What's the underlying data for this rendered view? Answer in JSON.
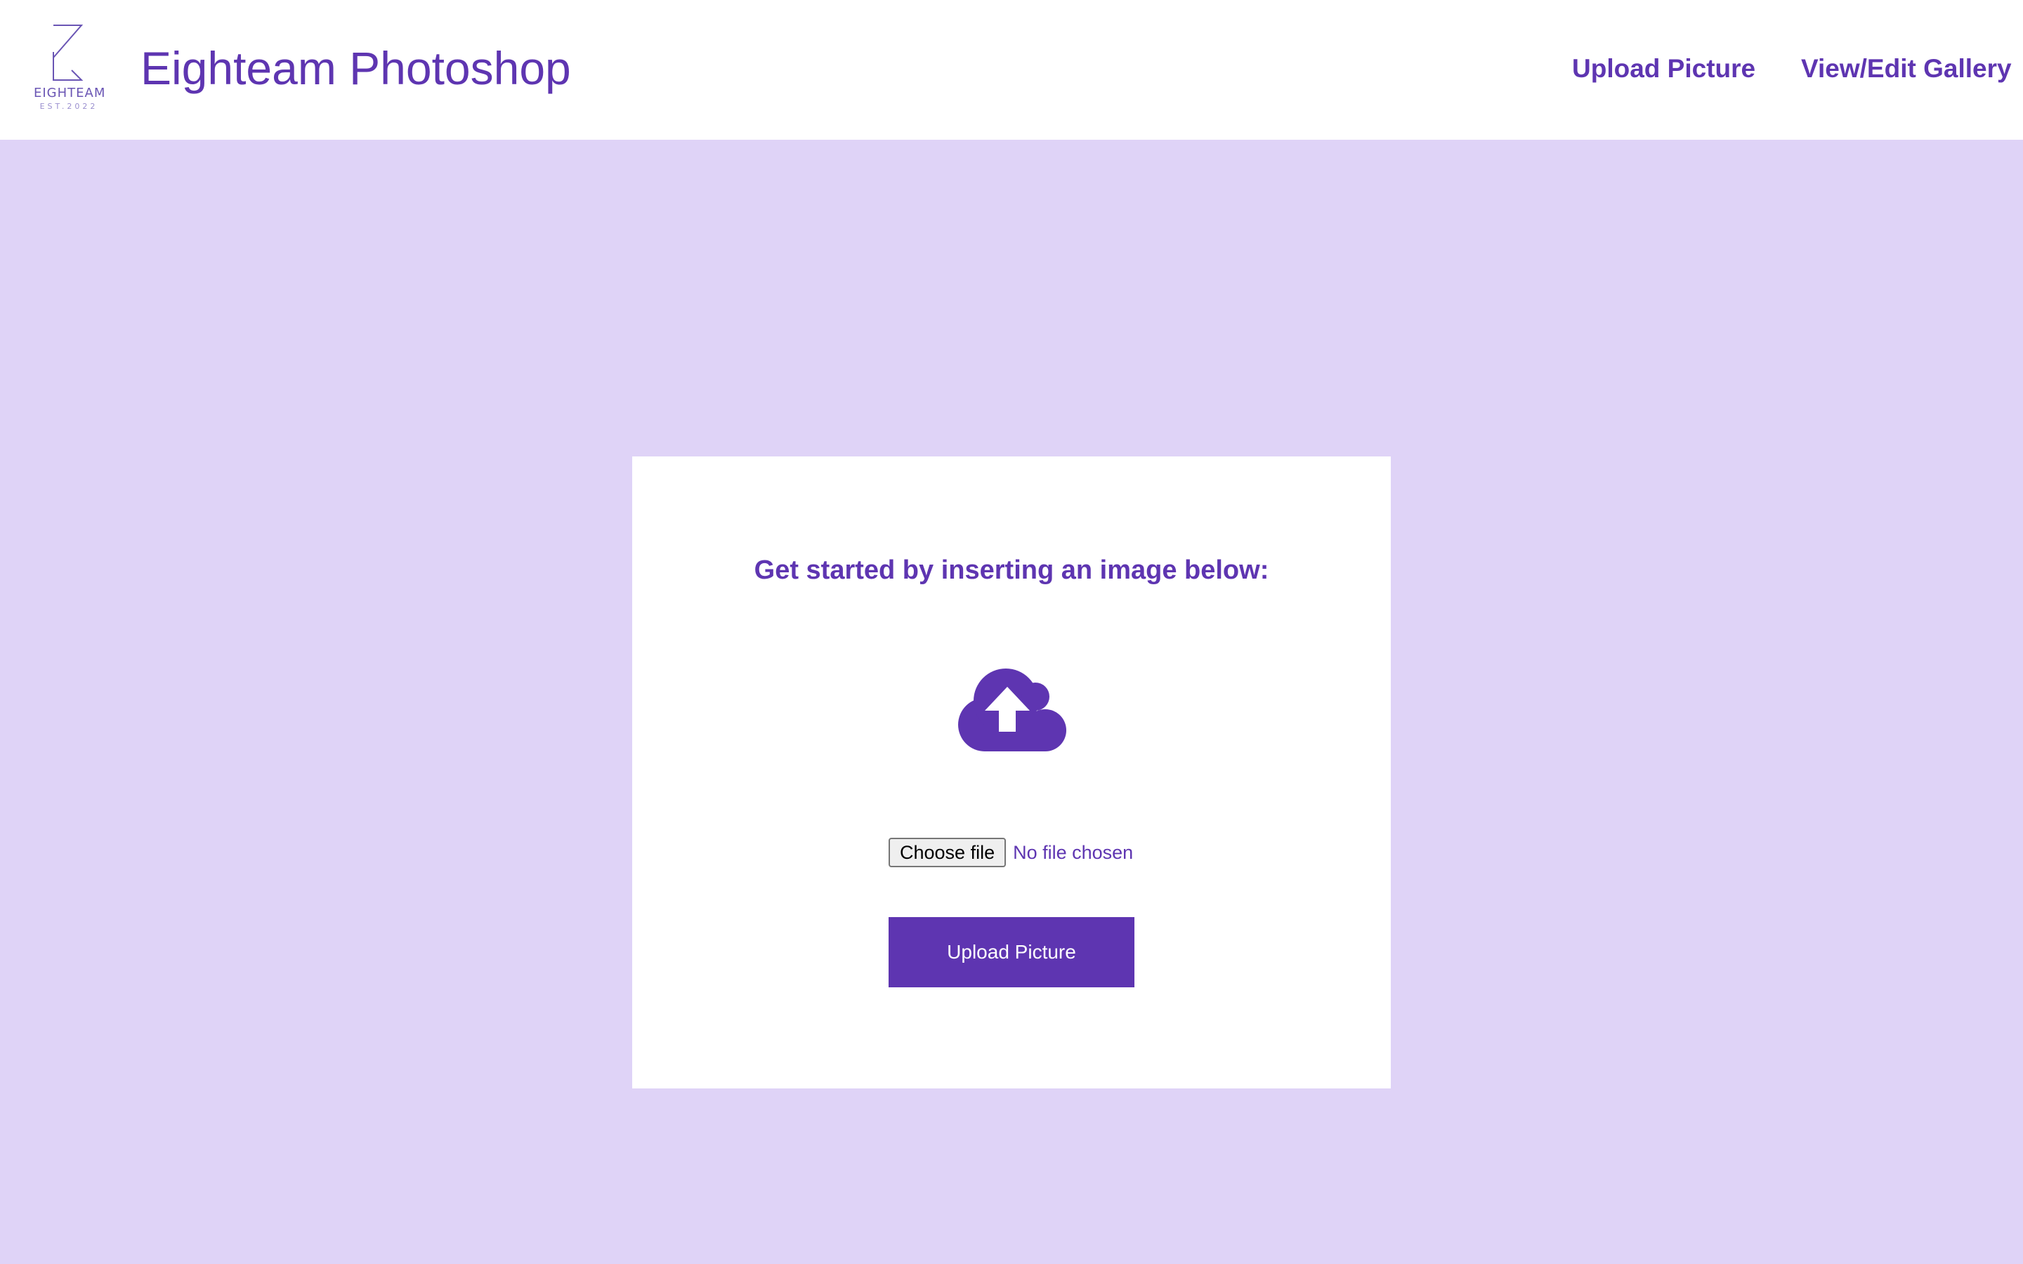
{
  "header": {
    "logo_text": "EIGHTEAM",
    "logo_sub": "EST.2022",
    "title": "Eighteam Photoshop",
    "nav": {
      "upload_label": "Upload Picture",
      "gallery_label": "View/Edit Gallery"
    }
  },
  "upload_card": {
    "heading": "Get started by inserting an image below:",
    "icon": "cloud-upload-icon",
    "file_input": {
      "button_label": "Choose file",
      "status": "No file chosen"
    },
    "submit_label": "Upload Picture"
  },
  "colors": {
    "accent": "#5e35b1",
    "background": "#dfd3f7",
    "surface": "#ffffff"
  }
}
